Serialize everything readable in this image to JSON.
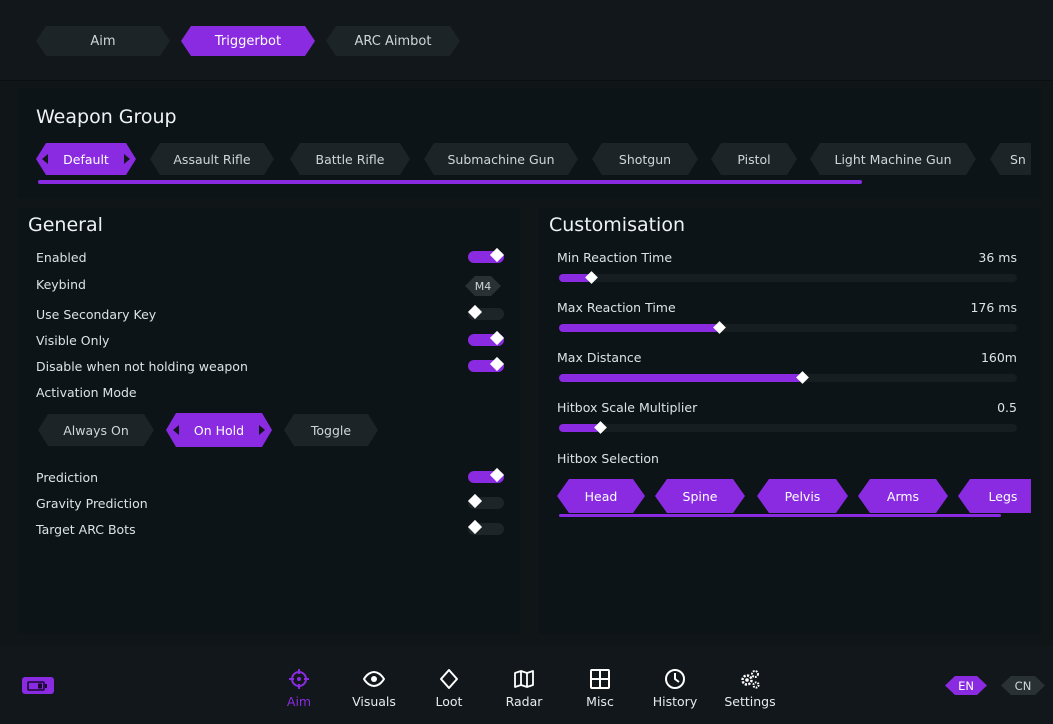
{
  "tabs": [
    {
      "label": "Aim",
      "active": false
    },
    {
      "label": "Triggerbot",
      "active": true
    },
    {
      "label": "ARC Aimbot",
      "active": false
    }
  ],
  "weapon_group": {
    "title": "Weapon Group",
    "items": [
      "Default",
      "Assault Rifle",
      "Battle Rifle",
      "Submachine Gun",
      "Shotgun",
      "Pistol",
      "Light Machine Gun",
      "Sn"
    ],
    "selected": "Default"
  },
  "general": {
    "title": "General",
    "enabled": {
      "label": "Enabled",
      "on": true
    },
    "keybind": {
      "label": "Keybind",
      "value": "M4"
    },
    "use_secondary_key": {
      "label": "Use Secondary Key",
      "on": false
    },
    "visible_only": {
      "label": "Visible Only",
      "on": true
    },
    "disable_not_holding": {
      "label": "Disable when not holding weapon",
      "on": true
    },
    "activation_mode": {
      "label": "Activation Mode",
      "options": [
        "Always On",
        "On Hold",
        "Toggle"
      ],
      "selected": "On Hold"
    },
    "prediction": {
      "label": "Prediction",
      "on": true
    },
    "gravity_prediction": {
      "label": "Gravity Prediction",
      "on": false
    },
    "target_arc_bots": {
      "label": "Target ARC Bots",
      "on": false
    }
  },
  "customisation": {
    "title": "Customisation",
    "min_reaction": {
      "label": "Min Reaction Time",
      "value": "36 ms",
      "fraction": 0.07
    },
    "max_reaction": {
      "label": "Max Reaction Time",
      "value": "176 ms",
      "fraction": 0.35
    },
    "max_distance": {
      "label": "Max Distance",
      "value": "160m",
      "fraction": 0.53
    },
    "hitbox_scale": {
      "label": "Hitbox Scale Multiplier",
      "value": "0.5",
      "fraction": 0.09
    },
    "hitbox_selection": {
      "label": "Hitbox Selection",
      "items": [
        "Head",
        "Spine",
        "Pelvis",
        "Arms",
        "Legs"
      ]
    }
  },
  "bottom_nav": {
    "items": [
      {
        "label": "Aim",
        "icon": "crosshair-icon",
        "active": true
      },
      {
        "label": "Visuals",
        "icon": "eye-icon",
        "active": false
      },
      {
        "label": "Loot",
        "icon": "diamond-icon",
        "active": false
      },
      {
        "label": "Radar",
        "icon": "map-icon",
        "active": false
      },
      {
        "label": "Misc",
        "icon": "grid-icon",
        "active": false
      },
      {
        "label": "History",
        "icon": "clock-icon",
        "active": false
      },
      {
        "label": "Settings",
        "icon": "gears-icon",
        "active": false
      }
    ]
  },
  "languages": {
    "en": "EN",
    "cn": "CN",
    "active": "EN"
  },
  "colors": {
    "accent": "#8a2be2",
    "background": "#101518",
    "panel": "#0d1418"
  }
}
